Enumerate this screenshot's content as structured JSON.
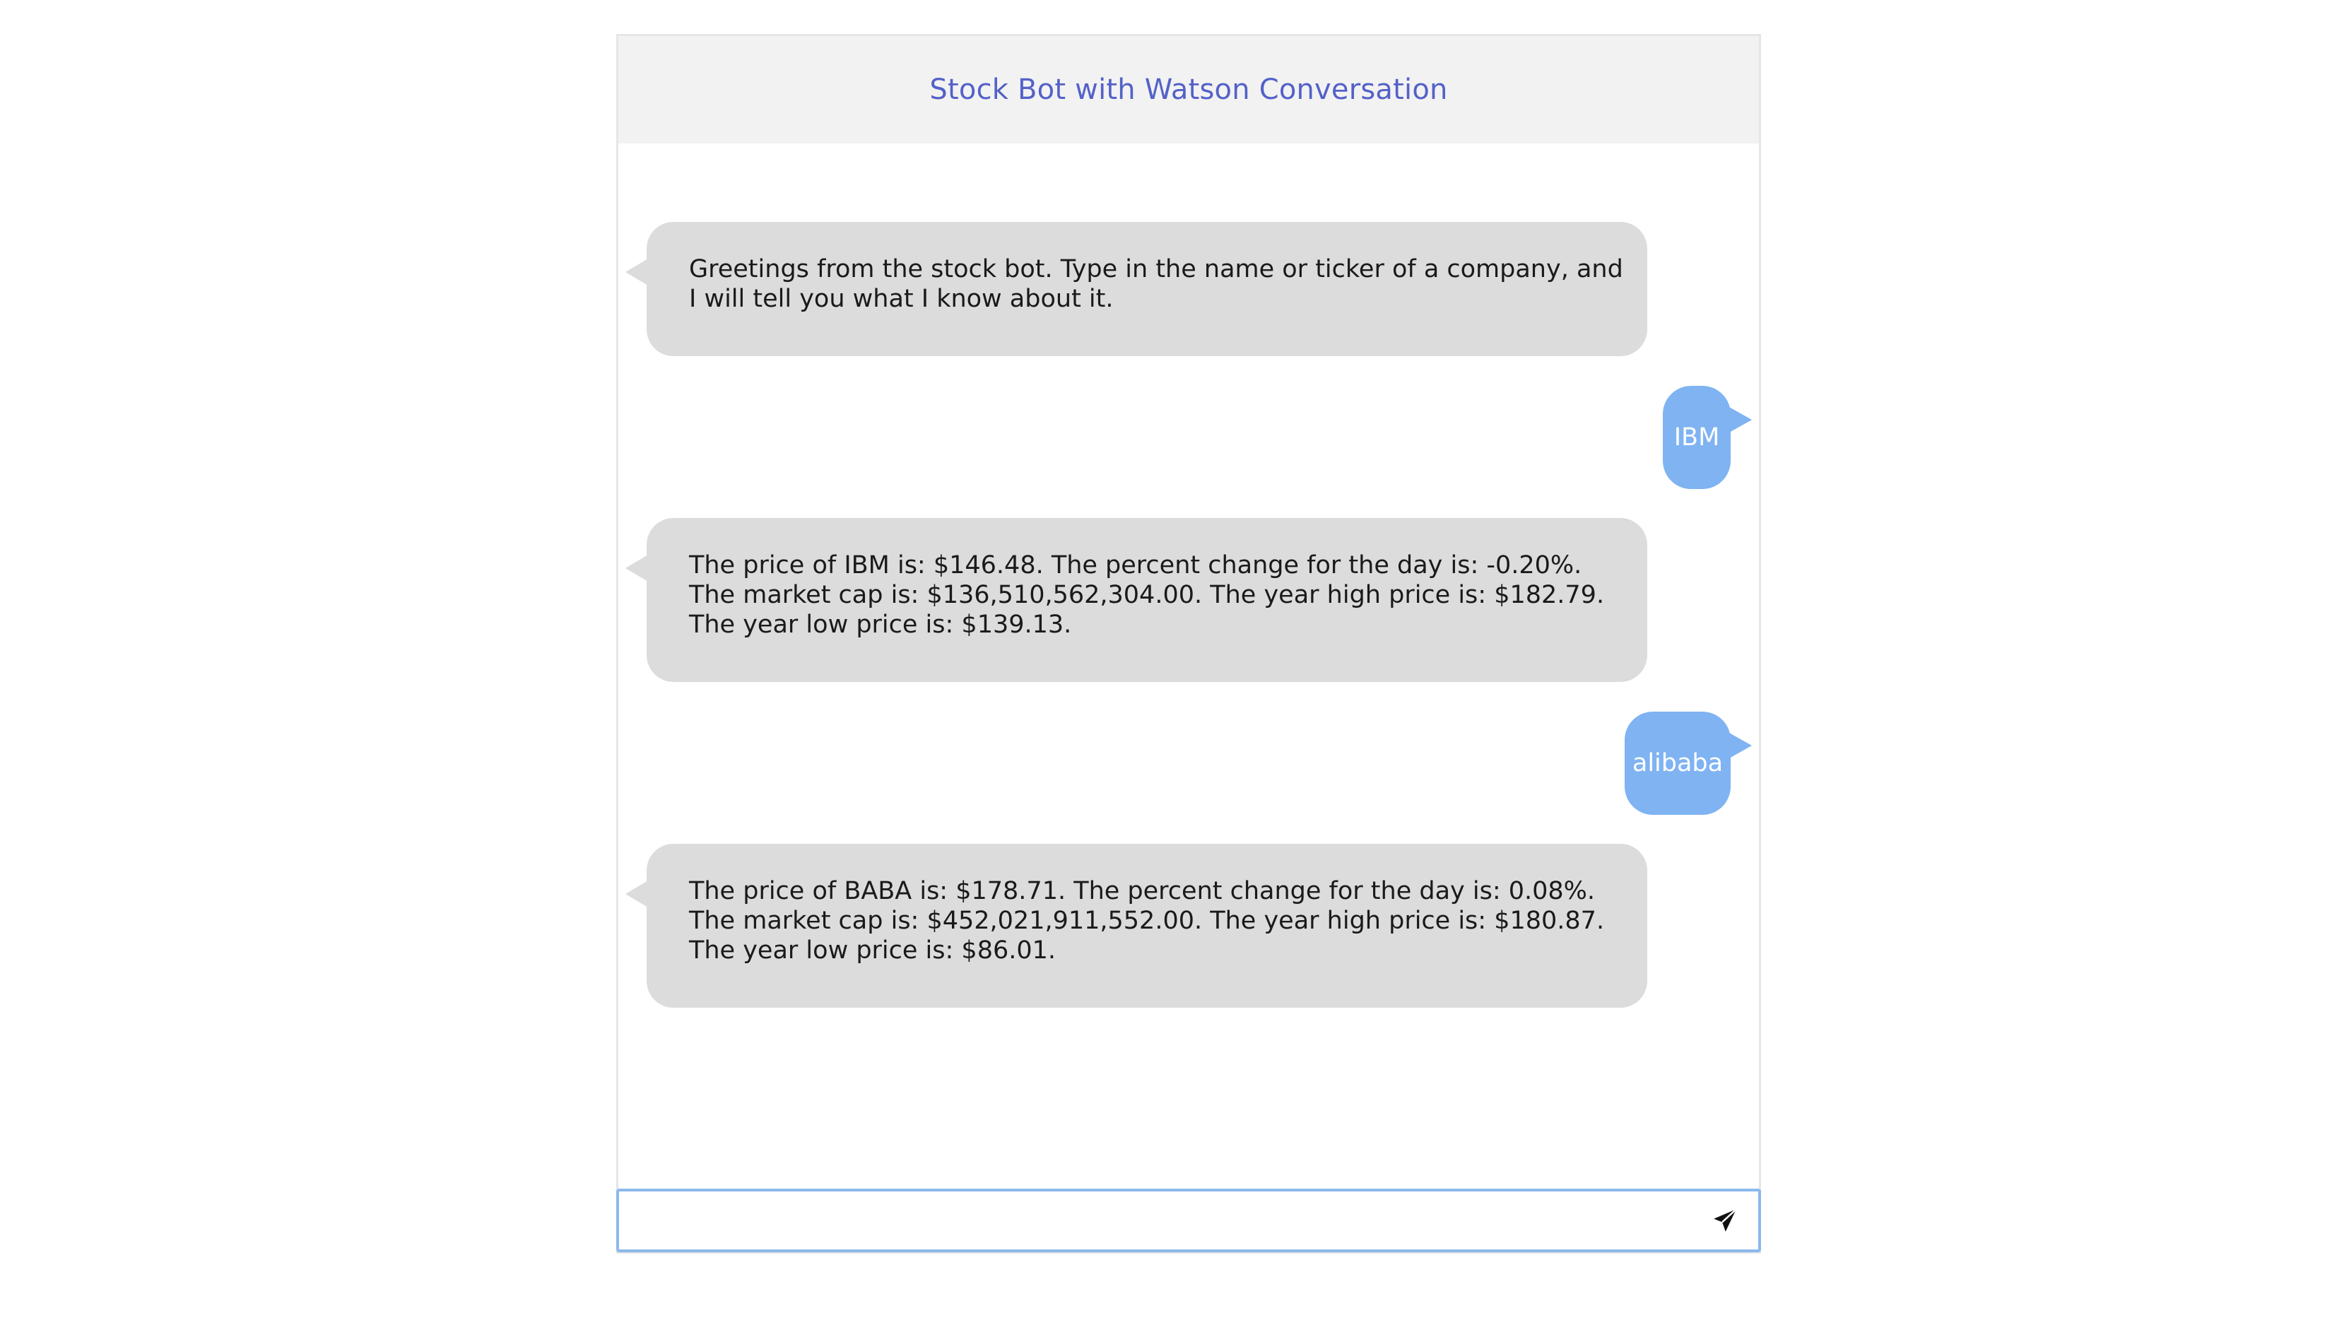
{
  "header": {
    "title": "Stock Bot with Watson Conversation"
  },
  "messages": [
    {
      "sender": "bot",
      "text": "Greetings from the stock bot. Type in the name or ticker of a company, and I will tell you what I know about it."
    },
    {
      "sender": "user",
      "text": "IBM"
    },
    {
      "sender": "bot",
      "text": "The price of IBM is: $146.48. The percent change for the day is: -0.20%. The market cap is: $136,510,562,304.00. The year high price is: $182.79. The year low price is: $139.13."
    },
    {
      "sender": "user",
      "text": "alibaba"
    },
    {
      "sender": "bot",
      "text": "The price of BABA is: $178.71. The percent change for the day is: 0.08%. The market cap is: $452,021,911,552.00. The year high price is: $180.87. The year low price is: $86.01."
    }
  ],
  "input": {
    "value": "",
    "placeholder": "",
    "send_icon": "send-icon"
  },
  "colors": {
    "header_title": "#5461c8",
    "bot_bubble": "#dcdcdc",
    "user_bubble": "#7fb3f2",
    "input_border": "#8cb9ec"
  }
}
